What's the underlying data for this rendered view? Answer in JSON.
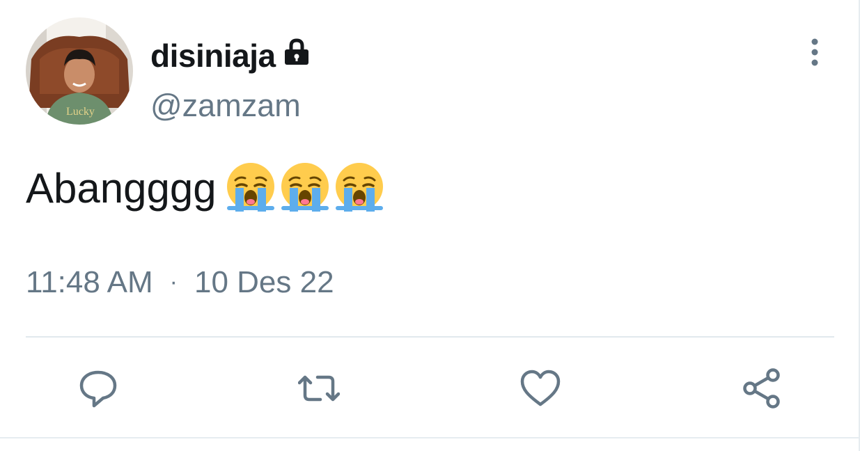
{
  "tweet": {
    "display_name": "disiniaja",
    "handle": "@zamzam",
    "text": "Abangggg",
    "emojis": [
      "loudly-crying-face",
      "loudly-crying-face",
      "loudly-crying-face"
    ],
    "time": "11:48 AM",
    "separator": "·",
    "date": "10 Des 22",
    "protected_icon": "lock-icon",
    "avatar_shirt_text": "Lucky"
  },
  "actions": [
    {
      "name": "reply",
      "icon": "comment-icon"
    },
    {
      "name": "retweet",
      "icon": "retweet-icon"
    },
    {
      "name": "like",
      "icon": "heart-icon"
    },
    {
      "name": "share",
      "icon": "share-icon"
    }
  ],
  "colors": {
    "text_primary": "#14171a",
    "text_secondary": "#657786",
    "icon": "#657786",
    "divider": "#e1e8ed"
  }
}
